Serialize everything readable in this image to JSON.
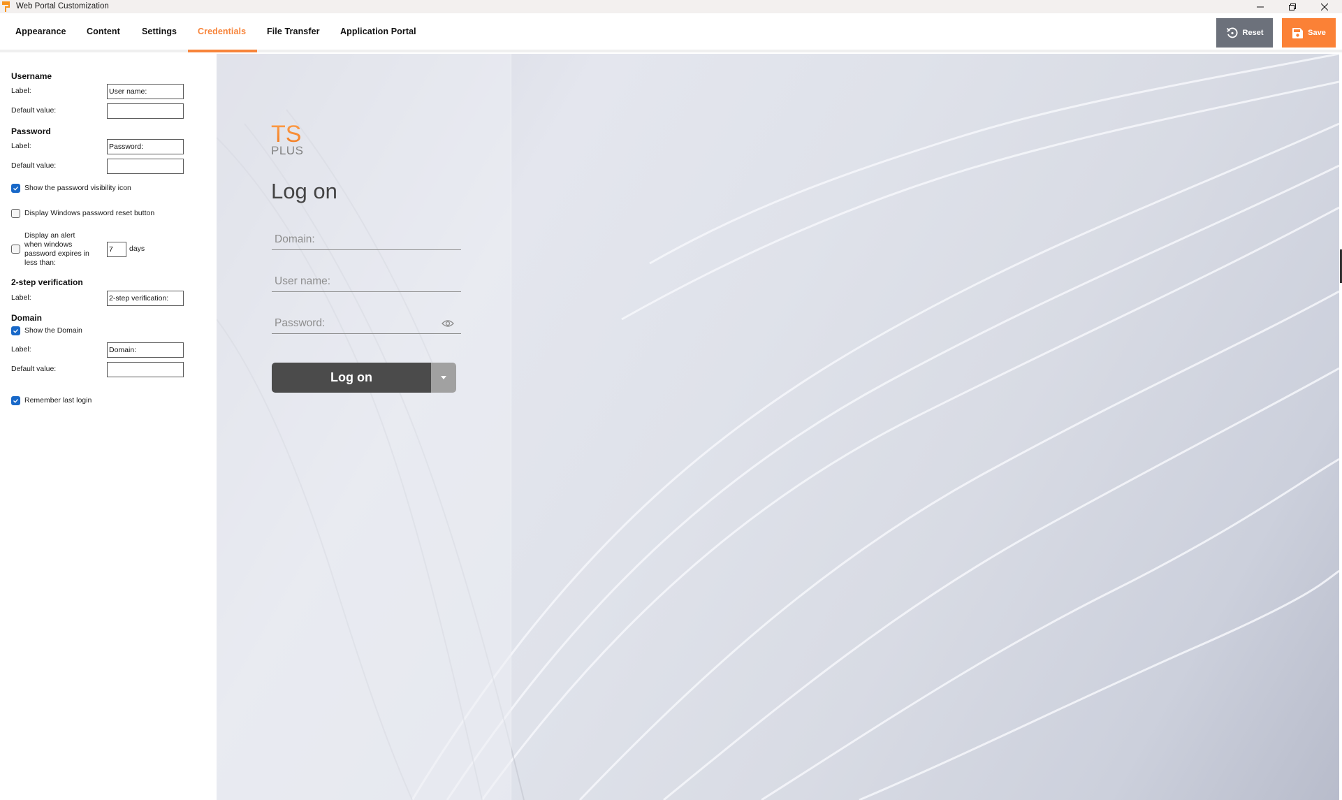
{
  "window": {
    "title": "Web Portal Customization",
    "app_icon": "paint-roller-icon",
    "controls": [
      "minimize-icon",
      "restore-icon",
      "close-icon"
    ]
  },
  "tabs": [
    {
      "label": "Appearance",
      "active": false
    },
    {
      "label": "Content",
      "active": false
    },
    {
      "label": "Settings",
      "active": false
    },
    {
      "label": "Credentials",
      "active": true
    },
    {
      "label": "File Transfer",
      "active": false
    },
    {
      "label": "Application Portal",
      "active": false
    }
  ],
  "toolbar": {
    "reset_label": "Reset",
    "reset_icon": "undo-icon",
    "save_label": "Save",
    "save_icon": "floppy-disk-icon"
  },
  "colors": {
    "accent": "#f7843a",
    "save_bg": "#fb8136",
    "reset_bg": "#6c717b",
    "checkbox": "#1868c8",
    "logon_button": "#4b4b4b",
    "logon_dropdown": "#a1a1a1"
  },
  "settings": {
    "username": {
      "heading": "Username",
      "label_caption": "Label:",
      "label_value": "User name:",
      "default_caption": "Default value:",
      "default_value": ""
    },
    "password": {
      "heading": "Password",
      "label_caption": "Label:",
      "label_value": "Password:",
      "default_caption": "Default value:",
      "default_value": ""
    },
    "show_visibility_icon": {
      "label": "Show the password visibility icon",
      "checked": true
    },
    "windows_reset_button": {
      "label": "Display Windows password reset button",
      "checked": false
    },
    "expiry_alert": {
      "label_lines": [
        "Display an alert",
        "when windows",
        "password expires in",
        "less than:"
      ],
      "checked": false,
      "days_value": "7",
      "days_unit": "days"
    },
    "two_step": {
      "heading": "2-step verification",
      "label_caption": "Label:",
      "label_value": "2-step verification:"
    },
    "domain": {
      "heading": "Domain",
      "show_label": "Show the Domain",
      "show_checked": true,
      "label_caption": "Label:",
      "label_value": "Domain:",
      "default_caption": "Default value:",
      "default_value": ""
    },
    "remember_last_login": {
      "label": "Remember last login",
      "checked": true
    }
  },
  "preview": {
    "logo_top": "TS",
    "logo_bottom": "PLUS",
    "title": "Log on",
    "fields": {
      "domain_placeholder": "Domain:",
      "username_placeholder": "User name:",
      "password_placeholder": "Password:"
    },
    "logon_button": "Log on",
    "dropdown_icon": "caret-down-icon",
    "password_icon": "eye-icon"
  }
}
